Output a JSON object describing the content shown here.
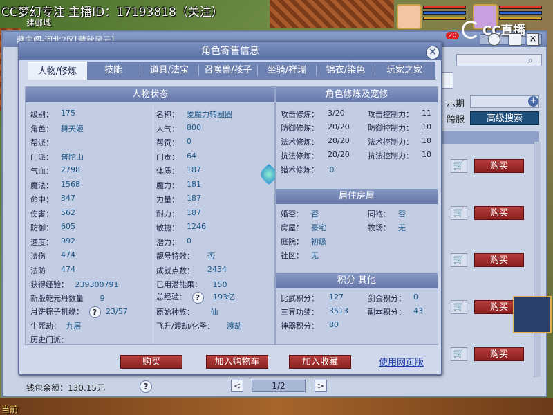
{
  "overlay": {
    "stream_title": "CC梦幻专注 主播ID：17193818（关注）",
    "city": "建邺城",
    "cc_brand": "CC直播",
    "notification_count": "20"
  },
  "shop": {
    "breadcrumb": "藏宝阁-河北2区[藏秋风云]",
    "show_period_label": "示期",
    "cross_server_label": "跨服",
    "advanced_search": "高级搜索",
    "buy_label": "购买",
    "wallet_label": "钱包余额：130.15元",
    "page": "1/2",
    "prev": "<",
    "next": ">",
    "help": "?"
  },
  "dialog": {
    "title": "角色寄售信息",
    "close": "×",
    "tabs": [
      "人物/修炼",
      "技能",
      "道具/法宝",
      "召唤兽/孩子",
      "坐骑/祥瑞",
      "锦衣/染色",
      "玩家之家"
    ],
    "buttons": {
      "buy": "购买",
      "add_cart": "加入购物车",
      "add_fav": "加入收藏",
      "web_version": "使用网页版"
    }
  },
  "status": {
    "header": "人物状态",
    "left": [
      {
        "label": "级别：",
        "value": "175"
      },
      {
        "label": "角色：",
        "value": "舞天姬"
      },
      {
        "label": "帮派：",
        "value": ""
      },
      {
        "label": "门派：",
        "value": "普陀山"
      },
      {
        "label": "气血：",
        "value": "2798"
      },
      {
        "label": "魔法：",
        "value": "1568"
      },
      {
        "label": "命中：",
        "value": "347"
      },
      {
        "label": "伤害：",
        "value": "562"
      },
      {
        "label": "防御：",
        "value": "605"
      },
      {
        "label": "速度：",
        "value": "992"
      },
      {
        "label": "法伤",
        "value": "474"
      },
      {
        "label": "法防",
        "value": "474"
      }
    ],
    "right": [
      {
        "label": "名称：",
        "value": "爱魔力转圈圈"
      },
      {
        "label": "人气：",
        "value": "800"
      },
      {
        "label": "帮贡：",
        "value": "0"
      },
      {
        "label": "门贡：",
        "value": "64"
      },
      {
        "label": "体质：",
        "value": "187"
      },
      {
        "label": "魔力：",
        "value": "181"
      },
      {
        "label": "力量：",
        "value": "187"
      },
      {
        "label": "耐力：",
        "value": "187"
      },
      {
        "label": "敏捷：",
        "value": "1246"
      },
      {
        "label": "潜力：",
        "value": "0"
      },
      {
        "label": "靓号特效：",
        "value": "否"
      },
      {
        "label": "成就点数：",
        "value": "2434"
      }
    ],
    "exp_label": "获得经验：",
    "exp_value": "239300791",
    "used_pot_label": "已用潜能果：",
    "used_pot_value": "150",
    "qianyuan_label": "新版乾元丹数量",
    "qianyuan_value": "9",
    "total_exp_label": "总经验：",
    "total_exp_value": "193亿",
    "zongzi_label": "月饼粽子机缘：",
    "zongzi_value": "23/57",
    "origin_race_label": "原始种族：",
    "origin_race_value": "仙",
    "shengsi_label": "生死劫：",
    "shengsi_value": "九层",
    "feisheng_label": "飞升/渡劫/化圣：",
    "feisheng_value": "渡劫",
    "history_label": "历史门派："
  },
  "cultivation": {
    "header": "角色修炼及宠修",
    "rows": [
      {
        "l1": "攻击修炼：",
        "v1": "3/20",
        "l2": "攻击控制力：",
        "v2": "11"
      },
      {
        "l1": "防御修炼：",
        "v1": "20/20",
        "l2": "防御控制力：",
        "v2": "10"
      },
      {
        "l1": "法术修炼：",
        "v1": "20/20",
        "l2": "法术控制力：",
        "v2": "10"
      },
      {
        "l1": "抗法修炼：",
        "v1": "20/20",
        "l2": "抗法控制力：",
        "v2": "10"
      }
    ],
    "hunt_label": "猎术修炼：",
    "hunt_value": "0"
  },
  "house": {
    "header": "居住房屋",
    "rows": [
      {
        "l1": "婚否：",
        "v1": "否",
        "l2": "同袍：",
        "v2": "否"
      },
      {
        "l1": "房屋：",
        "v1": "豪宅",
        "l2": "牧场：",
        "v2": "无"
      },
      {
        "l1": "庭院：",
        "v1": "初级",
        "l2": "",
        "v2": ""
      },
      {
        "l1": "社区：",
        "v1": "无",
        "l2": "",
        "v2": ""
      }
    ]
  },
  "points": {
    "header": "积分 其他",
    "rows": [
      {
        "l1": "比武积分：",
        "v1": "127",
        "l2": "剑会积分：",
        "v2": "0"
      },
      {
        "l1": "三界功绩：",
        "v1": "3513",
        "l2": "副本积分：",
        "v2": "43"
      },
      {
        "l1": "神器积分：",
        "v1": "80",
        "l2": "",
        "v2": ""
      }
    ]
  },
  "footer_game": {
    "current_label": "当前"
  }
}
